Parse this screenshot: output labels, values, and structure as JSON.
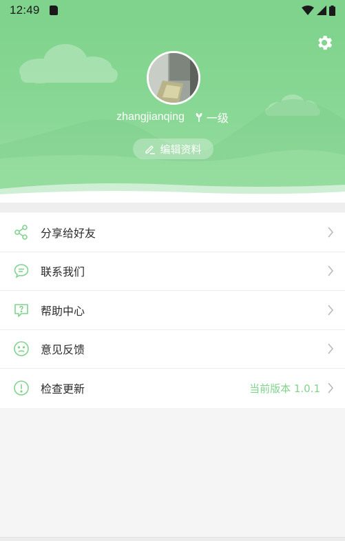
{
  "status_bar": {
    "time": "12:49"
  },
  "profile": {
    "username": "zhangjianqing",
    "level": "一级",
    "edit_label": "编辑资料"
  },
  "menu": {
    "items": [
      {
        "label": "分享给好友",
        "icon": "share-icon"
      },
      {
        "label": "联系我们",
        "icon": "chat-bubble-icon"
      },
      {
        "label": "帮助中心",
        "icon": "help-icon"
      },
      {
        "label": "意见反馈",
        "icon": "sad-face-icon"
      },
      {
        "label": "检查更新",
        "icon": "alert-circle-icon",
        "extra": "当前版本 1.0.1"
      }
    ]
  },
  "colors": {
    "accent": "#7fd38c",
    "header_top": "#7fd38c"
  }
}
